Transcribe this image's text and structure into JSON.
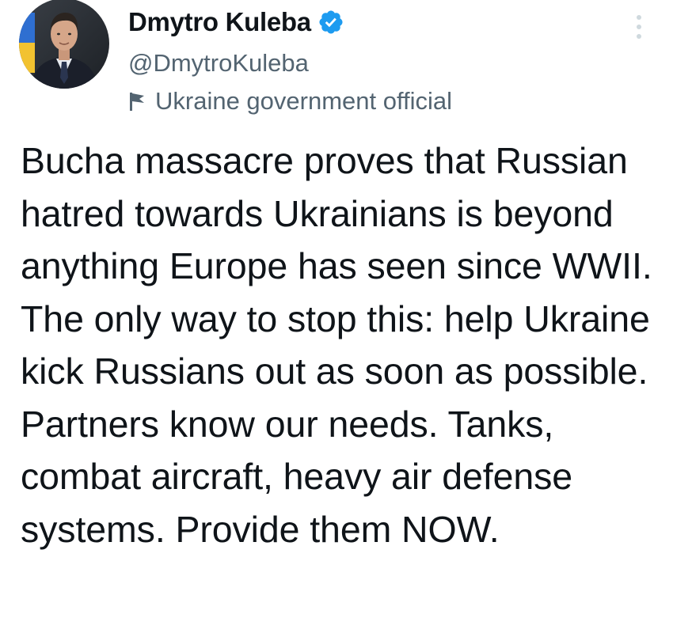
{
  "author": {
    "display_name": "Dmytro Kuleba",
    "handle": "@DmytroKuleba",
    "label": "Ukraine government official",
    "verified": true,
    "avatar_icon": "profile-photo",
    "label_icon": "flag-icon"
  },
  "tweet": {
    "text": "Bucha massacre proves that Russian hatred towards Ukrainians is beyond anything Europe has seen since WWII. The only way to stop this: help Ukraine kick Russians out as soon as possible. Partners know our needs. Tanks, combat aircraft, heavy air defense systems. Provide them NOW."
  },
  "menu": {
    "icon": "more-options-icon"
  },
  "colors": {
    "text": "#0f1419",
    "secondary": "#536471",
    "verified": "#1d9bf0",
    "background": "#ffffff"
  }
}
